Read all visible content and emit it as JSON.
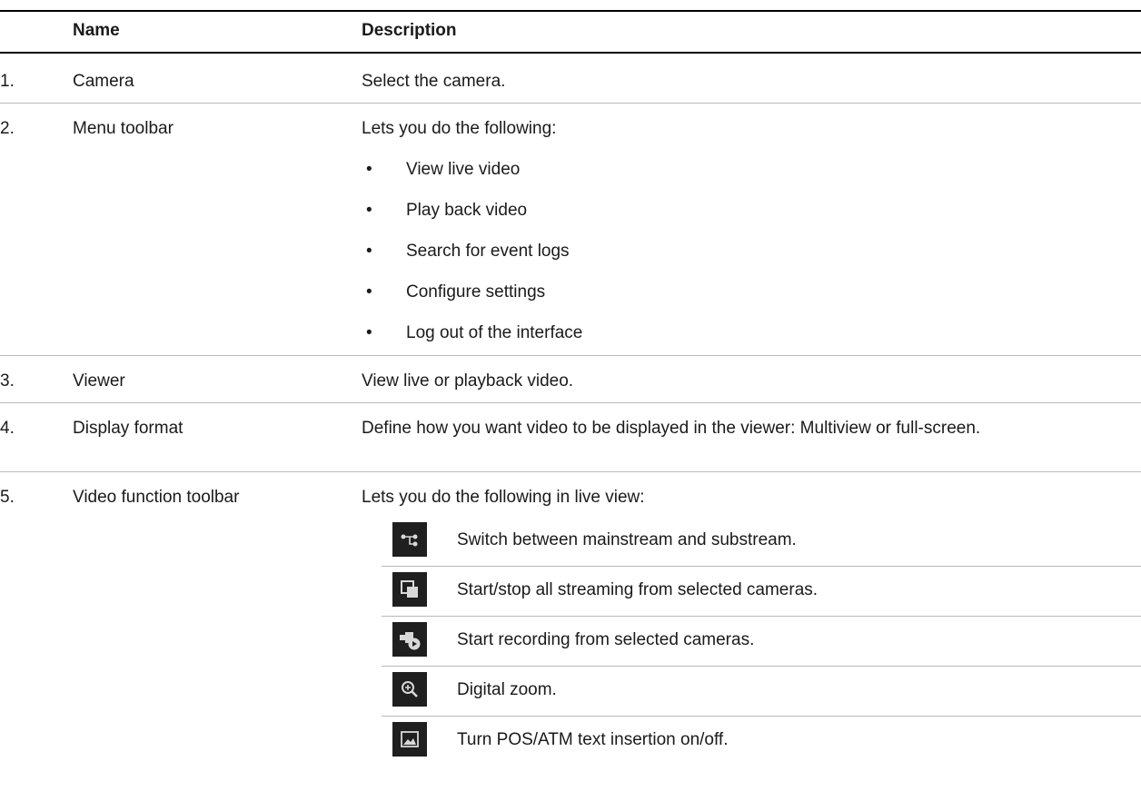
{
  "header": {
    "number": "",
    "name": "Name",
    "description": "Description"
  },
  "rows": [
    {
      "number": "1.",
      "name": "Camera",
      "description": "Select the camera."
    },
    {
      "number": "2.",
      "name": "Menu toolbar",
      "description": "Lets you do the following:",
      "bullets": [
        "View live video",
        "Play back video",
        "Search for event logs",
        "Configure settings",
        "Log out of the interface"
      ]
    },
    {
      "number": "3.",
      "name": "Viewer",
      "description": "View live or playback video."
    },
    {
      "number": "4.",
      "name": "Display format",
      "description": "Define how you want video to be displayed in the viewer: Multiview or full-screen."
    },
    {
      "number": "5.",
      "name": "Video function toolbar",
      "description": "Lets you do the following in live view:",
      "functions": [
        {
          "icon": "stream-switch-icon",
          "text": "Switch between mainstream and substream."
        },
        {
          "icon": "all-streams-icon",
          "text": "Start/stop all streaming from selected cameras."
        },
        {
          "icon": "record-camera-icon",
          "text": "Start recording from selected cameras."
        },
        {
          "icon": "digital-zoom-icon",
          "text": "Digital zoom."
        },
        {
          "icon": "text-insertion-icon",
          "text": "Turn POS/ATM text insertion on/off."
        }
      ]
    }
  ],
  "colors": {
    "icon_bg": "#1f1f1f",
    "icon_fg": "#d8d8d8",
    "rule": "#000000",
    "separator": "#b9b9b9"
  }
}
